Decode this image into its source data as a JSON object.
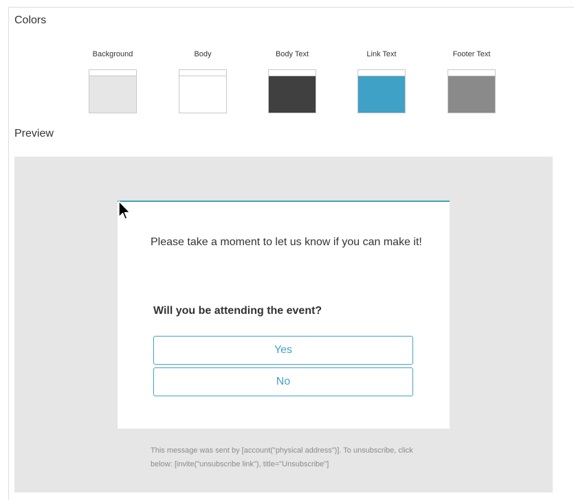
{
  "colors_section": {
    "title": "Colors",
    "swatches": [
      {
        "label": "Background",
        "color": "#e6e6e6"
      },
      {
        "label": "Body",
        "color": "#ffffff"
      },
      {
        "label": "Body Text",
        "color": "#404040"
      },
      {
        "label": "Link Text",
        "color": "#3fa1c5"
      },
      {
        "label": "Footer Text",
        "color": "#8a8a8a"
      }
    ]
  },
  "preview_section": {
    "title": "Preview",
    "message": "Please take a moment to let us know if you can make it!",
    "question": "Will you be attending the event?",
    "choices": [
      "Yes",
      "No"
    ],
    "footer": "This message was sent by [account(\"physical address\")]. To unsubscribe, click below: [invite(\"unsubscribe link\"), title=\"Unsubscribe\"]"
  }
}
